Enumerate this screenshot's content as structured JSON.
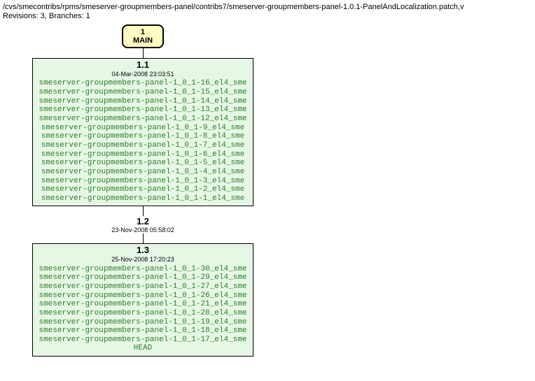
{
  "header": {
    "path": "/cvs/smecontribs/rpms/smeserver-groupmembers-panel/contribs7/smeserver-groupmembers-panel-1.0.1-PanelAndLocalization.patch,v",
    "revline": "Revisions: 3, Branches: 1"
  },
  "branch": {
    "number": "1",
    "name": "MAIN"
  },
  "rev1": {
    "num": "1.1",
    "date": "04-Mar-2008 23:03:51",
    "tags": [
      "smeserver-groupmembers-panel-1_0_1-16_el4_sme",
      "smeserver-groupmembers-panel-1_0_1-15_el4_sme",
      "smeserver-groupmembers-panel-1_0_1-14_el4_sme",
      "smeserver-groupmembers-panel-1_0_1-13_el4_sme",
      "smeserver-groupmembers-panel-1_0_1-12_el4_sme",
      "smeserver-groupmembers-panel-1_0_1-9_el4_sme",
      "smeserver-groupmembers-panel-1_0_1-8_el4_sme",
      "smeserver-groupmembers-panel-1_0_1-7_el4_sme",
      "smeserver-groupmembers-panel-1_0_1-6_el4_sme",
      "smeserver-groupmembers-panel-1_0_1-5_el4_sme",
      "smeserver-groupmembers-panel-1_0_1-4_el4_sme",
      "smeserver-groupmembers-panel-1_0_1-3_el4_sme",
      "smeserver-groupmembers-panel-1_0_1-2_el4_sme",
      "smeserver-groupmembers-panel-1_0_1-1_el4_sme"
    ]
  },
  "rev2": {
    "num": "1.2",
    "date": "23-Nov-2008 05:58:02"
  },
  "rev3": {
    "num": "1.3",
    "date": "25-Nov-2008 17:20:23",
    "tags": [
      "smeserver-groupmembers-panel-1_0_1-30_el4_sme",
      "smeserver-groupmembers-panel-1_0_1-29_el4_sme",
      "smeserver-groupmembers-panel-1_0_1-27_el4_sme",
      "smeserver-groupmembers-panel-1_0_1-26_el4_sme",
      "smeserver-groupmembers-panel-1_0_1-21_el4_sme",
      "smeserver-groupmembers-panel-1_0_1-20_el4_sme",
      "smeserver-groupmembers-panel-1_0_1-19_el4_sme",
      "smeserver-groupmembers-panel-1_0_1-18_el4_sme",
      "smeserver-groupmembers-panel-1_0_1-17_el4_sme"
    ],
    "head": "HEAD"
  }
}
